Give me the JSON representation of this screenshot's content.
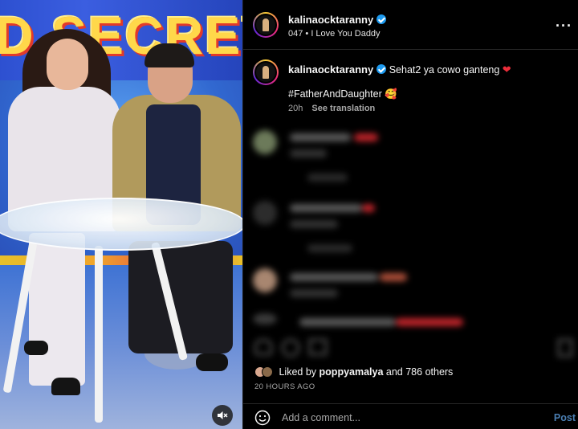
{
  "photo": {
    "banner_text": "D SECRET",
    "mute_icon": "speaker-muted-icon"
  },
  "post": {
    "username": "kalinaocktaranny",
    "audio": "047 • I Love You Daddy",
    "caption_text": "Sehat2 ya cowo ganteng",
    "hashtag": "#FatherAndDaughter",
    "emoji_heart": "❤",
    "emoji_face": "🥰",
    "age": "20h",
    "see_translation": "See translation"
  },
  "likes": {
    "prefix": "Liked by",
    "user": "poppyamalya",
    "suffix": "and 786 others"
  },
  "timestamp": "20 HOURS AGO",
  "comment": {
    "placeholder": "Add a comment...",
    "post_label": "Post"
  },
  "colors": {
    "verified": "#1d9bf0",
    "heart": "#ed2d3a",
    "post_button": "#4b7fb3"
  }
}
